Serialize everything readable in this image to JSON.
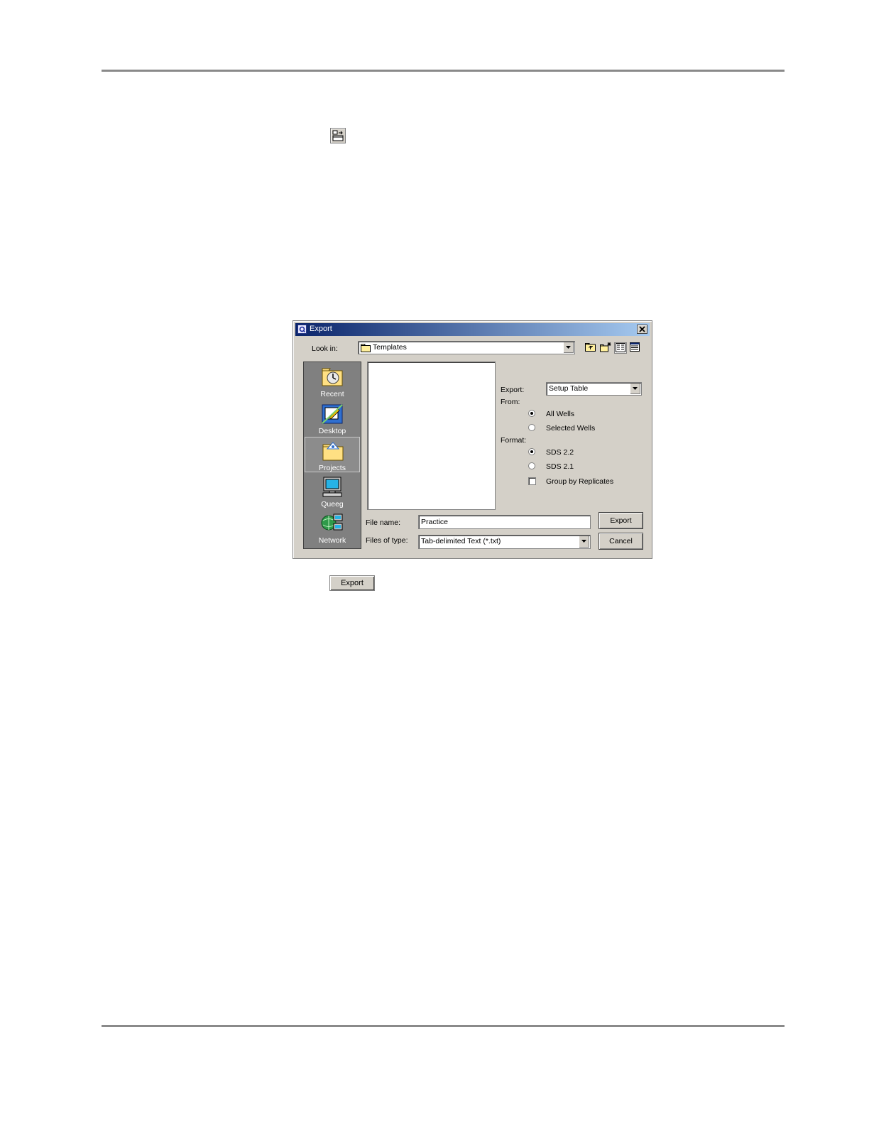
{
  "dialog": {
    "title": "Export",
    "look_in_label": "Look in:",
    "look_in_value": "Templates",
    "places": [
      {
        "label": "Recent",
        "icon": "recent-folder-icon"
      },
      {
        "label": "Desktop",
        "icon": "desktop-icon"
      },
      {
        "label": "Projects",
        "icon": "projects-folder-icon",
        "selected": true
      },
      {
        "label": "Queeg",
        "icon": "computer-icon"
      },
      {
        "label": "Network",
        "icon": "network-icon"
      }
    ],
    "export_label": "Export:",
    "export_value": "Setup Table",
    "from_label": "From:",
    "from_options": [
      {
        "label": "All Wells",
        "checked": true
      },
      {
        "label": "Selected Wells",
        "checked": false
      }
    ],
    "format_label": "Format:",
    "format_options": [
      {
        "label": "SDS 2.2",
        "checked": true
      },
      {
        "label": "SDS 2.1",
        "checked": false
      }
    ],
    "group_by_replicates_label": "Group by Replicates",
    "file_name_label": "File name:",
    "file_name_value": "Practice",
    "files_of_type_label": "Files of type:",
    "files_of_type_value": "Tab-delimited Text (*.txt)",
    "export_button": "Export",
    "cancel_button": "Cancel"
  },
  "standalone_export_button": "Export"
}
